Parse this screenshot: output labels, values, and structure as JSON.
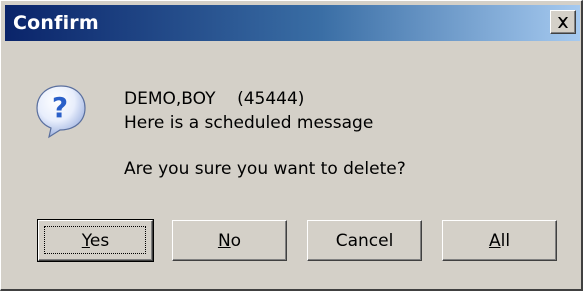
{
  "window": {
    "title": "Confirm",
    "close_glyph": "×"
  },
  "icon": {
    "name": "question-icon",
    "glyph": "?",
    "color": "#2a5fc8"
  },
  "message": {
    "line1": "DEMO,BOY    (45444)",
    "line2": "Here is a scheduled message",
    "line3": "Are you sure you want to delete?"
  },
  "buttons": [
    {
      "label": "Yes",
      "mnemonic": "Y",
      "rest": "es",
      "default": true
    },
    {
      "label": "No",
      "mnemonic": "N",
      "rest": "o",
      "default": false
    },
    {
      "label": "Cancel",
      "mnemonic": "",
      "rest": "Cancel",
      "default": false
    },
    {
      "label": "All",
      "mnemonic": "A",
      "rest": "ll",
      "default": false
    }
  ]
}
